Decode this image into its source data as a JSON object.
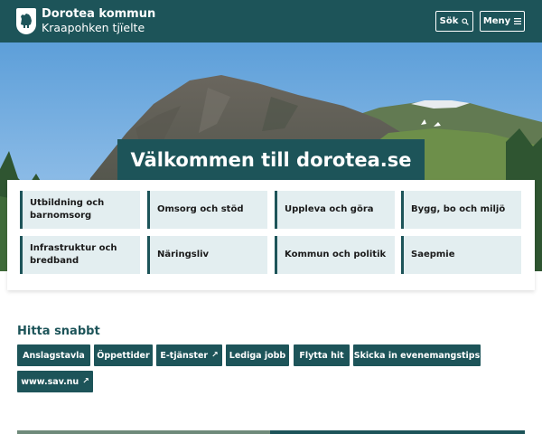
{
  "header": {
    "logo_name": "Dorotea kommun",
    "logo_sub": "Kraapohken tjïelte",
    "search_label": "Sök",
    "menu_label": "Meny"
  },
  "hero": {
    "title": "Välkommen till dorotea.se"
  },
  "categories": [
    {
      "label": "Utbildning och barnomsorg"
    },
    {
      "label": "Omsorg och stöd"
    },
    {
      "label": "Uppleva och göra"
    },
    {
      "label": "Bygg, bo och miljö"
    },
    {
      "label": "Infrastruktur och bredband"
    },
    {
      "label": "Näringsliv"
    },
    {
      "label": "Kommun och politik"
    },
    {
      "label": "Saepmie"
    }
  ],
  "quick": {
    "title": "Hitta snabbt",
    "links": [
      {
        "label": "Anslagstavla"
      },
      {
        "label": "Öppettider"
      },
      {
        "label": "E-tjänster"
      },
      {
        "label": "Lediga jobb"
      },
      {
        "label": "Flytta hit"
      },
      {
        "label": "Skicka in evenemangstips"
      },
      {
        "label": "www.sav.nu"
      }
    ]
  },
  "colors": {
    "brand": "#1d5459",
    "tile_bg": "#e3eef0"
  },
  "icons": {
    "search": "search-icon",
    "menu": "hamburger-icon",
    "external": "external-link-icon",
    "crest": "bear-crest-icon"
  }
}
